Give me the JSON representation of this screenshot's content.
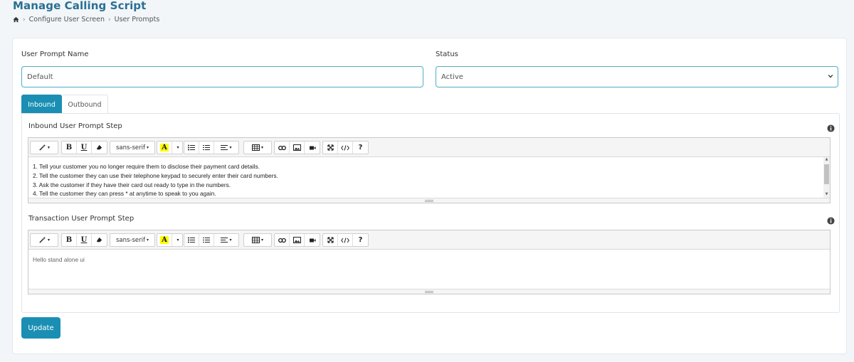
{
  "header": {
    "title": "Manage Calling Script",
    "breadcrumb": [
      "Configure User Screen",
      "User Prompts"
    ]
  },
  "form": {
    "prompt_name_label": "User Prompt Name",
    "prompt_name_value": "Default",
    "status_label": "Status",
    "status_value": "Active"
  },
  "tabs": [
    {
      "label": "Inbound",
      "active": true
    },
    {
      "label": "Outbound",
      "active": false
    }
  ],
  "editors": {
    "font_name": "sans-serif",
    "inbound": {
      "label": "Inbound User Prompt Step",
      "lines": [
        "1. Tell your customer you no longer require them to disclose their payment card details.",
        "2. Tell the customer they can use their telephone keypad to securely enter their card numbers.",
        "3. Ask the customer if they have their card out ready to type in the numbers.",
        "4. Tell the customer they can press * at anytime to speak to you again."
      ]
    },
    "transaction": {
      "label": "Transaction User Prompt Step",
      "content": "Hello stand alone ui"
    }
  },
  "toolbar_icons": [
    "magic-wand-icon",
    "bold-icon",
    "underline-icon",
    "eraser-icon",
    "font-family-dropdown",
    "font-color-icon",
    "unordered-list-icon",
    "ordered-list-icon",
    "paragraph-align-icon",
    "table-icon",
    "link-icon",
    "picture-icon",
    "video-icon",
    "fullscreen-icon",
    "code-view-icon",
    "help-icon"
  ],
  "toolbar_glyphs": {
    "bold": "B",
    "underline": "U",
    "help": "?",
    "color": "A",
    "caret": "▾"
  },
  "actions": {
    "update_label": "Update"
  },
  "colors": {
    "primary": "#1a8fb3",
    "title": "#2a6f94",
    "border_focus": "#4fb0c6"
  }
}
